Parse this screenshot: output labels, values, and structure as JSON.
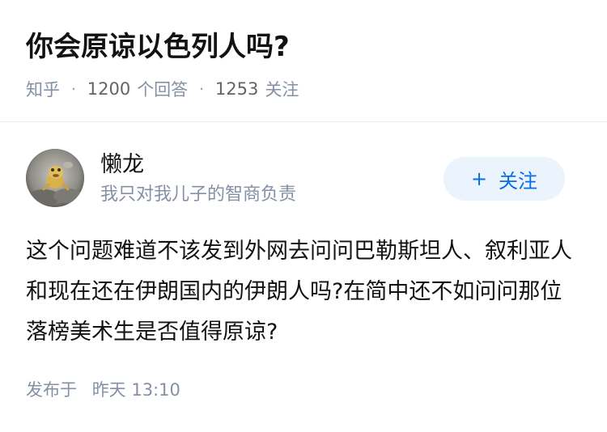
{
  "question": {
    "title": "你会原谅以色列人吗?",
    "site": "知乎",
    "answer_count": "1200",
    "answer_label": "个回答",
    "follow_count": "1253",
    "follow_label": "关注"
  },
  "answer": {
    "author": {
      "name": "懒龙",
      "bio": "我只对我儿子的智商负责",
      "avatar_icon": "avatar-photo"
    },
    "follow_button": {
      "icon": "plus-icon",
      "label": "关注"
    },
    "content": "这个问题难道不该发到外网去问问巴勒斯坦人、叙利亚人和现在还在伊朗国内的伊朗人吗?在简中还不如问问那位落榜美术生是否值得原谅?",
    "posted_label": "发布于",
    "posted_time": "昨天 13:10"
  },
  "colors": {
    "primary_text": "#121212",
    "secondary_text": "#8590a6",
    "accent_blue": "#056de8",
    "button_bg": "#ebf3fc",
    "divider": "#ebebeb"
  }
}
